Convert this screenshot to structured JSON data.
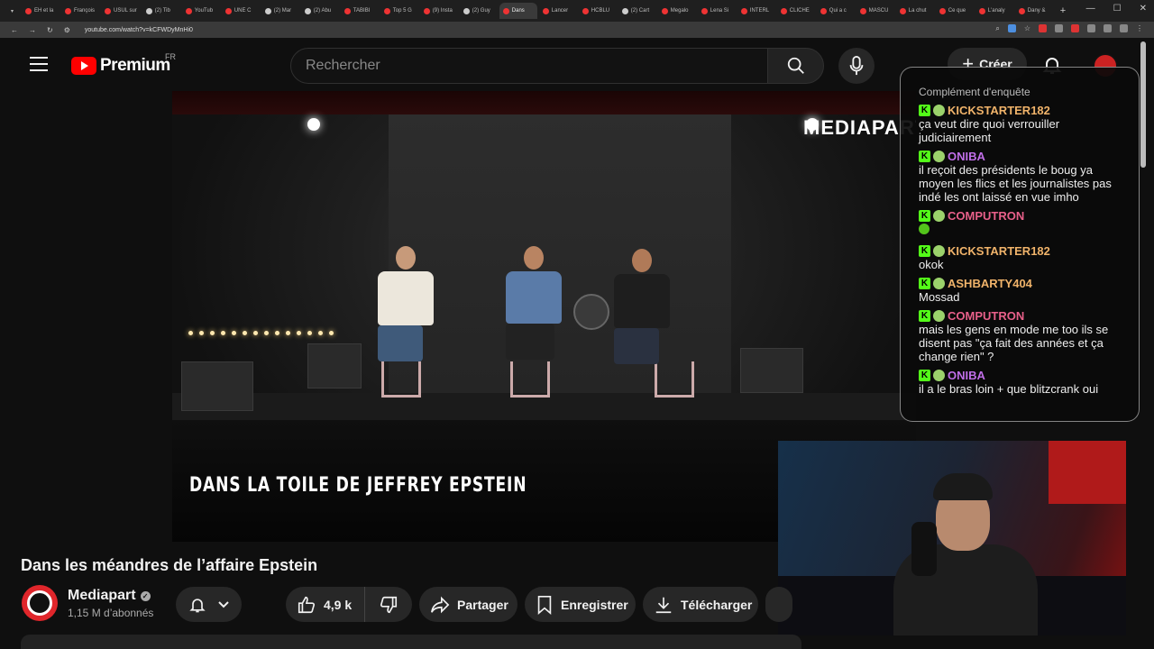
{
  "browser": {
    "tabs": [
      {
        "label": "EH et la"
      },
      {
        "label": "François"
      },
      {
        "label": "USUL sur"
      },
      {
        "label": "(2) Tib"
      },
      {
        "label": "YouTub"
      },
      {
        "label": "UNE C"
      },
      {
        "label": "(2) Mar"
      },
      {
        "label": "(2) Abu"
      },
      {
        "label": "TABIBI"
      },
      {
        "label": "Top 5 G"
      },
      {
        "label": "(9) Insta"
      },
      {
        "label": "(2) Guy"
      },
      {
        "label": "Dans"
      },
      {
        "label": "Lancer"
      },
      {
        "label": "HCBLU"
      },
      {
        "label": "(2) Cart"
      },
      {
        "label": "Megalo"
      },
      {
        "label": "Lena Si"
      },
      {
        "label": "INTERL"
      },
      {
        "label": "CLICHE"
      },
      {
        "label": "Qui a c"
      },
      {
        "label": "MASCU"
      },
      {
        "label": "La chut"
      },
      {
        "label": "Ce que"
      },
      {
        "label": "L'analy"
      },
      {
        "label": "Dany &"
      }
    ],
    "url": "youtube.com/watch?v=kCFWDyMnHi0"
  },
  "header": {
    "logo_text": "Premium",
    "logo_region": "FR",
    "search_placeholder": "Rechercher",
    "create_label": "Créer"
  },
  "video": {
    "caption": "DANS LA TOILE DE JEFFREY EPSTEIN",
    "watermark": "MEDIAPART",
    "title": "Dans les méandres de l’affaire Epstein"
  },
  "channel": {
    "name": "Mediapart",
    "subscribers": "1,15 M d’abonnés"
  },
  "actions": {
    "likes": "4,9 k",
    "share_label": "Partager",
    "save_label": "Enregistrer",
    "download_label": "Télécharger"
  },
  "chat": {
    "top_line": "Complément d'enquête",
    "messages": [
      {
        "user": "KICKSTARTER182",
        "color": "#f0b36a",
        "text": "ça veut dire quoi verrouiller judiciairement"
      },
      {
        "user": "ONIBA",
        "color": "#c06ee8",
        "text": "il reçoit des présidents le boug ya moyen les flics et les journalistes pas indé les ont laissé en vue imho"
      },
      {
        "user": "COMPUTRON",
        "color": "#e8608a",
        "text": ""
      },
      {
        "user": "KICKSTARTER182",
        "color": "#f0b36a",
        "text": "okok"
      },
      {
        "user": "ASHBARTY404",
        "color": "#f0b36a",
        "text": "Mossad"
      },
      {
        "user": "COMPUTRON",
        "color": "#e8608a",
        "text": "mais les gens en mode me too ils se disent pas \"ça fait des années et ça change rien\" ?"
      },
      {
        "user": "ONIBA",
        "color": "#c06ee8",
        "text": "il a le bras loin + que blitzcrank oui"
      }
    ]
  }
}
